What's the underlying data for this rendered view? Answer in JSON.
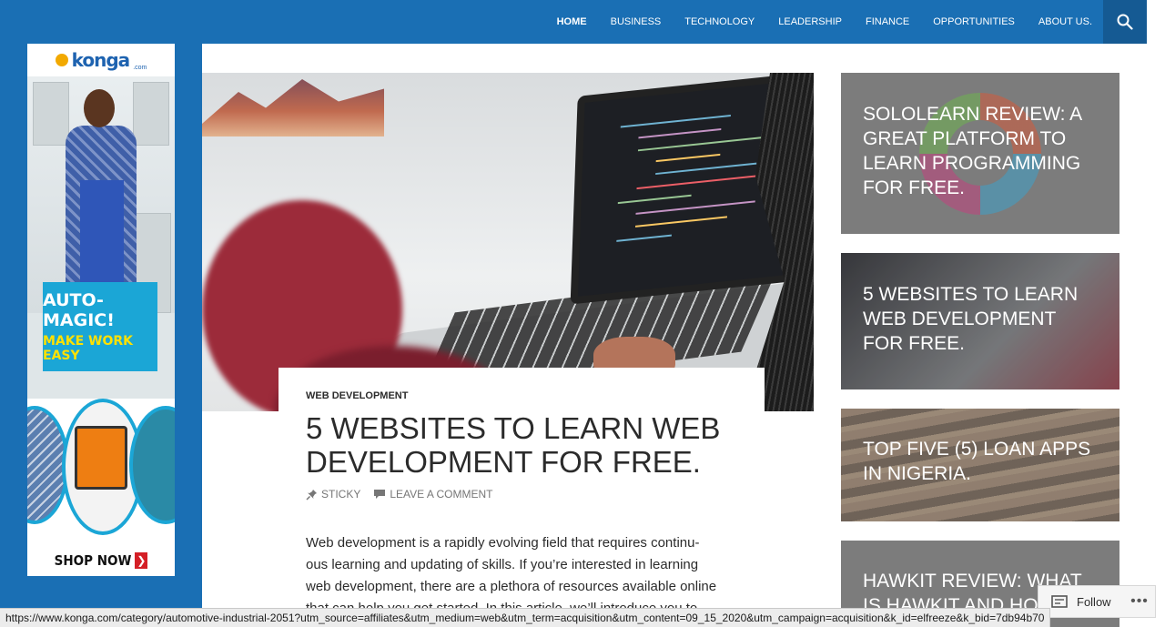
{
  "nav": {
    "items": [
      {
        "label": "HOME",
        "active": true
      },
      {
        "label": "BUSINESS",
        "active": false
      },
      {
        "label": "TECHNOLOGY",
        "active": false
      },
      {
        "label": "LEADERSHIP",
        "active": false
      },
      {
        "label": "FINANCE",
        "active": false
      },
      {
        "label": "OPPORTUNITIES",
        "active": false
      },
      {
        "label": "ABOUT US.",
        "active": false
      }
    ],
    "search_icon": "search-icon"
  },
  "ad": {
    "brand": "konga",
    "brand_suffix": ".com",
    "headline": "AUTO-MAGIC!",
    "subheadline": "MAKE WORK EASY",
    "cta": "SHOP NOW",
    "cta_arrow": "❯"
  },
  "post": {
    "category": "WEB DEVELOPMENT",
    "title": "5 WEBSITES TO LEARN WEB DEVELOPMENT FOR FREE.",
    "sticky_label": "STICKY",
    "comment_label": "LEAVE A COMMENT",
    "body_lines": [
      "Web development is a rapidly evolving field that requires continu-",
      "ous learning and updating of skills. If you’re interested in learning",
      "web development, there are a plethora of resources available online",
      "that can help you get started. In this article, we’ll introduce you to"
    ]
  },
  "sidebar": {
    "cards": [
      {
        "title": "SOLOLEARN REVIEW: A GREAT PLATFORM TO LEARN PROGRAMMING FOR FREE."
      },
      {
        "title": "5 WEBSITES TO LEARN WEB DEVELOPMENT FOR FREE."
      },
      {
        "title": "TOP FIVE (5) LOAN APPS IN NIGERIA."
      },
      {
        "title": "HAWKIT REVIEW: WHAT IS HAWKIT AND HOW"
      }
    ]
  },
  "follow": {
    "label": "Follow",
    "more": "•••"
  },
  "status_url": "https://www.konga.com/category/automotive-industrial-2051?utm_source=affiliates&utm_medium=web&utm_term=acquisition&utm_content=09_15_2020&utm_campaign=acquisition&k_id=elfreeze&k_bid=7db94b70",
  "colors": {
    "brand_blue": "#1a6fb4",
    "text": "#2b2b2b",
    "meta": "#767676"
  }
}
